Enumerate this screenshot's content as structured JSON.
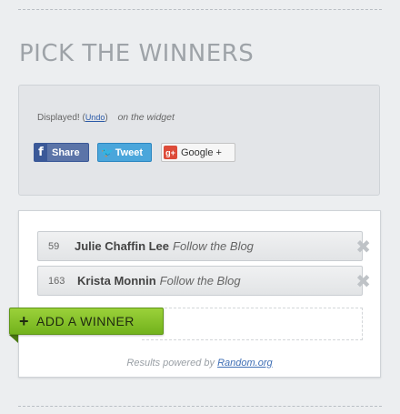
{
  "section_title": "PICK THE WINNERS",
  "share": {
    "displayed_text": "Displayed!",
    "undo_label": "Undo",
    "widget_text": "on the widget",
    "facebook": {
      "label": "Share",
      "icon": "facebook-icon",
      "glyph": "f"
    },
    "twitter": {
      "label": "Tweet",
      "icon": "twitter-bird-icon",
      "glyph": "🐦"
    },
    "google": {
      "label": "Google +",
      "icon": "google-plus-icon",
      "glyph": "g+"
    }
  },
  "winners": [
    {
      "number": "59",
      "name": "Julie Chaffin Lee",
      "entry": "Follow the Blog"
    },
    {
      "number": "163",
      "name": "Krista Monnin",
      "entry": "Follow the Blog"
    }
  ],
  "remove_glyph": "✖",
  "add_winner": {
    "plus": "+",
    "label": "ADD A WINNER"
  },
  "footer": {
    "text": "Results powered by",
    "link_label": "Random.org"
  },
  "colors": {
    "accent_green": "#7dbd23",
    "facebook_blue": "#3b5998",
    "twitter_blue": "#4aa6db",
    "google_red": "#dd4b39"
  }
}
